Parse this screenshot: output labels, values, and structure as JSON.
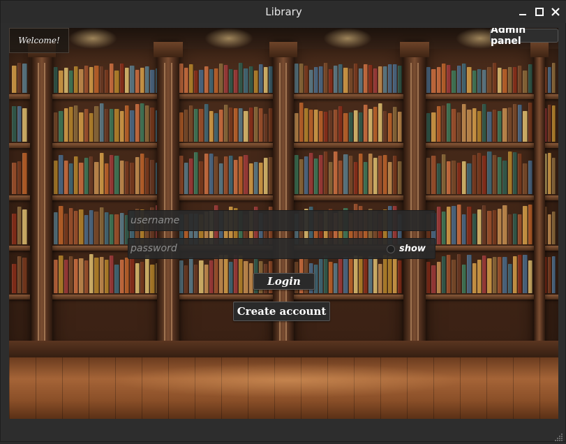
{
  "window": {
    "title": "Library",
    "controls": [
      "minimize-icon",
      "maximize-icon",
      "close-icon"
    ]
  },
  "welcome": {
    "text": "Welcome!"
  },
  "admin_panel": {
    "label": "Admin panel"
  },
  "login_form": {
    "username": {
      "placeholder": "username",
      "value": ""
    },
    "password": {
      "placeholder": "password",
      "value": ""
    },
    "show_toggle": {
      "label": "show",
      "checked": false
    },
    "login_label": "Login",
    "create_account_label": "Create account"
  },
  "colors": {
    "window_bg": "#2d2d2d",
    "field_bg": "#2a2a2a",
    "button_bg": "#2a2a2a",
    "text": "#ffffff",
    "placeholder": "#8d8d8d"
  }
}
